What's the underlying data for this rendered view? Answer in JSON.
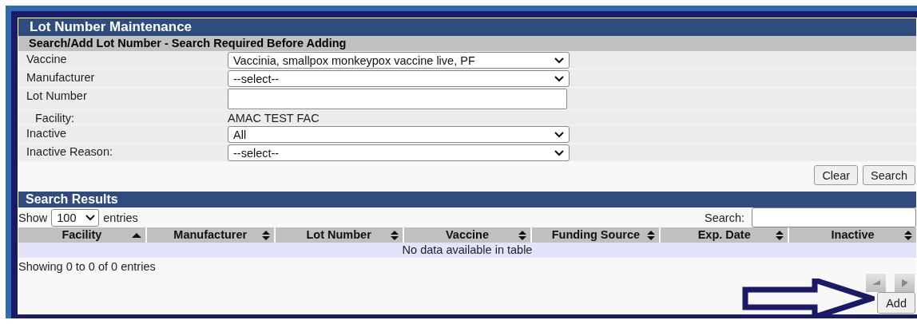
{
  "title": "Lot Number Maintenance",
  "subtitle": "Search/Add Lot Number - Search Required Before Adding",
  "fields": [
    {
      "kind": "select",
      "label": "Vaccine",
      "value": "Vaccinia, smallpox monkeypox vaccine live, PF"
    },
    {
      "kind": "select",
      "label": "Manufacturer",
      "value": "--select--"
    },
    {
      "kind": "input",
      "label": "Lot Number"
    },
    {
      "kind": "text",
      "label": "Facility:",
      "value": "AMAC TEST FAC"
    },
    {
      "kind": "select",
      "label": "Inactive",
      "value": "All"
    },
    {
      "kind": "select",
      "label": "Inactive Reason:",
      "value": "--select--"
    }
  ],
  "form_buttons": [
    "Clear",
    "Search"
  ],
  "results": {
    "title": "Search Results",
    "show_label": "Show",
    "page_size": "100",
    "entries_label": "entries",
    "search_label": "Search:",
    "columns": [
      {
        "label": "Facility",
        "sorted": true
      },
      {
        "label": "Manufacturer",
        "sorted": false
      },
      {
        "label": "Lot Number",
        "sorted": false
      },
      {
        "label": "Vaccine",
        "sorted": false
      },
      {
        "label": "Funding Source",
        "sorted": false
      },
      {
        "label": "Exp. Date",
        "sorted": false
      },
      {
        "label": "Inactive",
        "sorted": false
      }
    ],
    "empty_message": "No data available in table",
    "info": "Showing 0 to 0 of 0 entries",
    "add_button": "Add"
  }
}
